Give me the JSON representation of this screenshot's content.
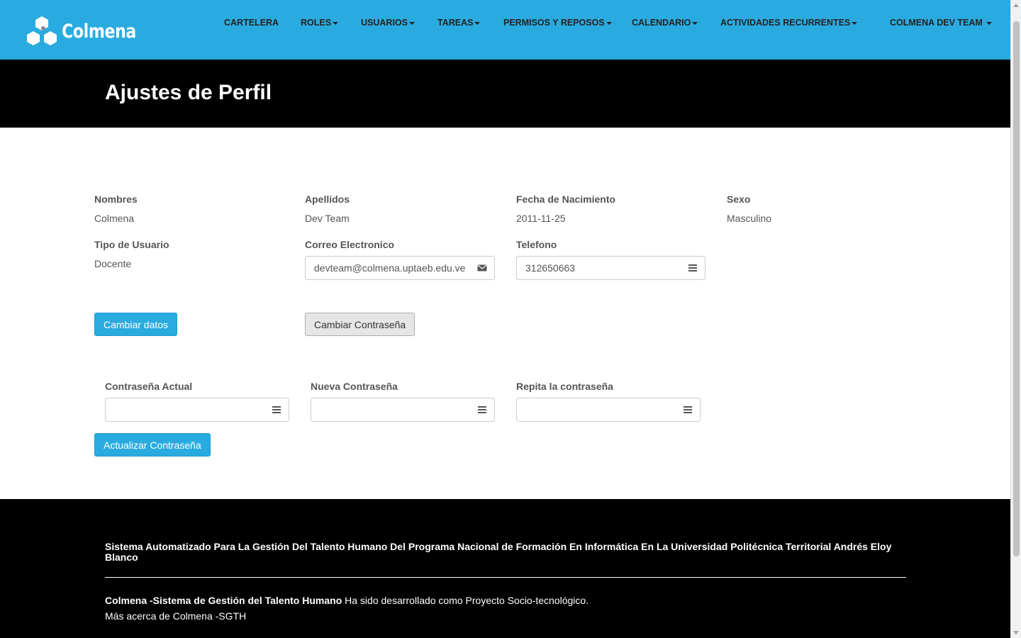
{
  "brand": {
    "name": "Colmena"
  },
  "nav": {
    "items": [
      {
        "label": "CARTELERA",
        "dropdown": false
      },
      {
        "label": "ROLES",
        "dropdown": true
      },
      {
        "label": "USUARIOS",
        "dropdown": true
      },
      {
        "label": "TAREAS",
        "dropdown": true
      },
      {
        "label": "PERMISOS Y REPOSOS",
        "dropdown": true
      },
      {
        "label": "CALENDARIO",
        "dropdown": true
      },
      {
        "label": "ACTIVIDADES RECURRENTES",
        "dropdown": true
      }
    ],
    "user_menu": "COLMENA DEV TEAM"
  },
  "page": {
    "title": "Ajustes de Perfil"
  },
  "profile": {
    "nombres": {
      "label": "Nombres",
      "value": "Colmena"
    },
    "apellidos": {
      "label": "Apellidos",
      "value": "Dev Team"
    },
    "fecha": {
      "label": "Fecha de Nacimiento",
      "value": "2011-11-25"
    },
    "sexo": {
      "label": "Sexo",
      "value": "Masculino"
    },
    "tipo": {
      "label": "Tipo de Usuario",
      "value": "Docente"
    },
    "correo": {
      "label": "Correo Electronico",
      "value": "devteam@colmena.uptaeb.edu.ve"
    },
    "telefono": {
      "label": "Telefono",
      "value": "312650663"
    }
  },
  "buttons": {
    "cambiar_datos": "Cambiar datos",
    "cambiar_contrasena": "Cambiar Contraseña",
    "actualizar_contrasena": "Actualizar Contraseña"
  },
  "password": {
    "actual": {
      "label": "Contraseña Actual",
      "value": ""
    },
    "nueva": {
      "label": "Nueva Contraseña",
      "value": ""
    },
    "repita": {
      "label": "Repita la contraseña",
      "value": ""
    }
  },
  "footer": {
    "heading": "Sistema Automatizado Para La Gestión Del Talento Humano Del Programa Nacional de Formación En Informática En La Universidad Politécnica Territorial Andrés Eloy Blanco",
    "line1_bold": "Colmena -Sistema de Gestión del Talento Humano",
    "line1_rest": " Ha sido desarrollado como Proyecto Socio-tecnológico.",
    "line2": "Más acerca de Colmena -SGTH"
  },
  "colors": {
    "primary": "#2aabe0",
    "dark": "#000000"
  },
  "icons": {
    "email": "envelope-icon",
    "phone": "list-icon",
    "password": "list-icon"
  }
}
